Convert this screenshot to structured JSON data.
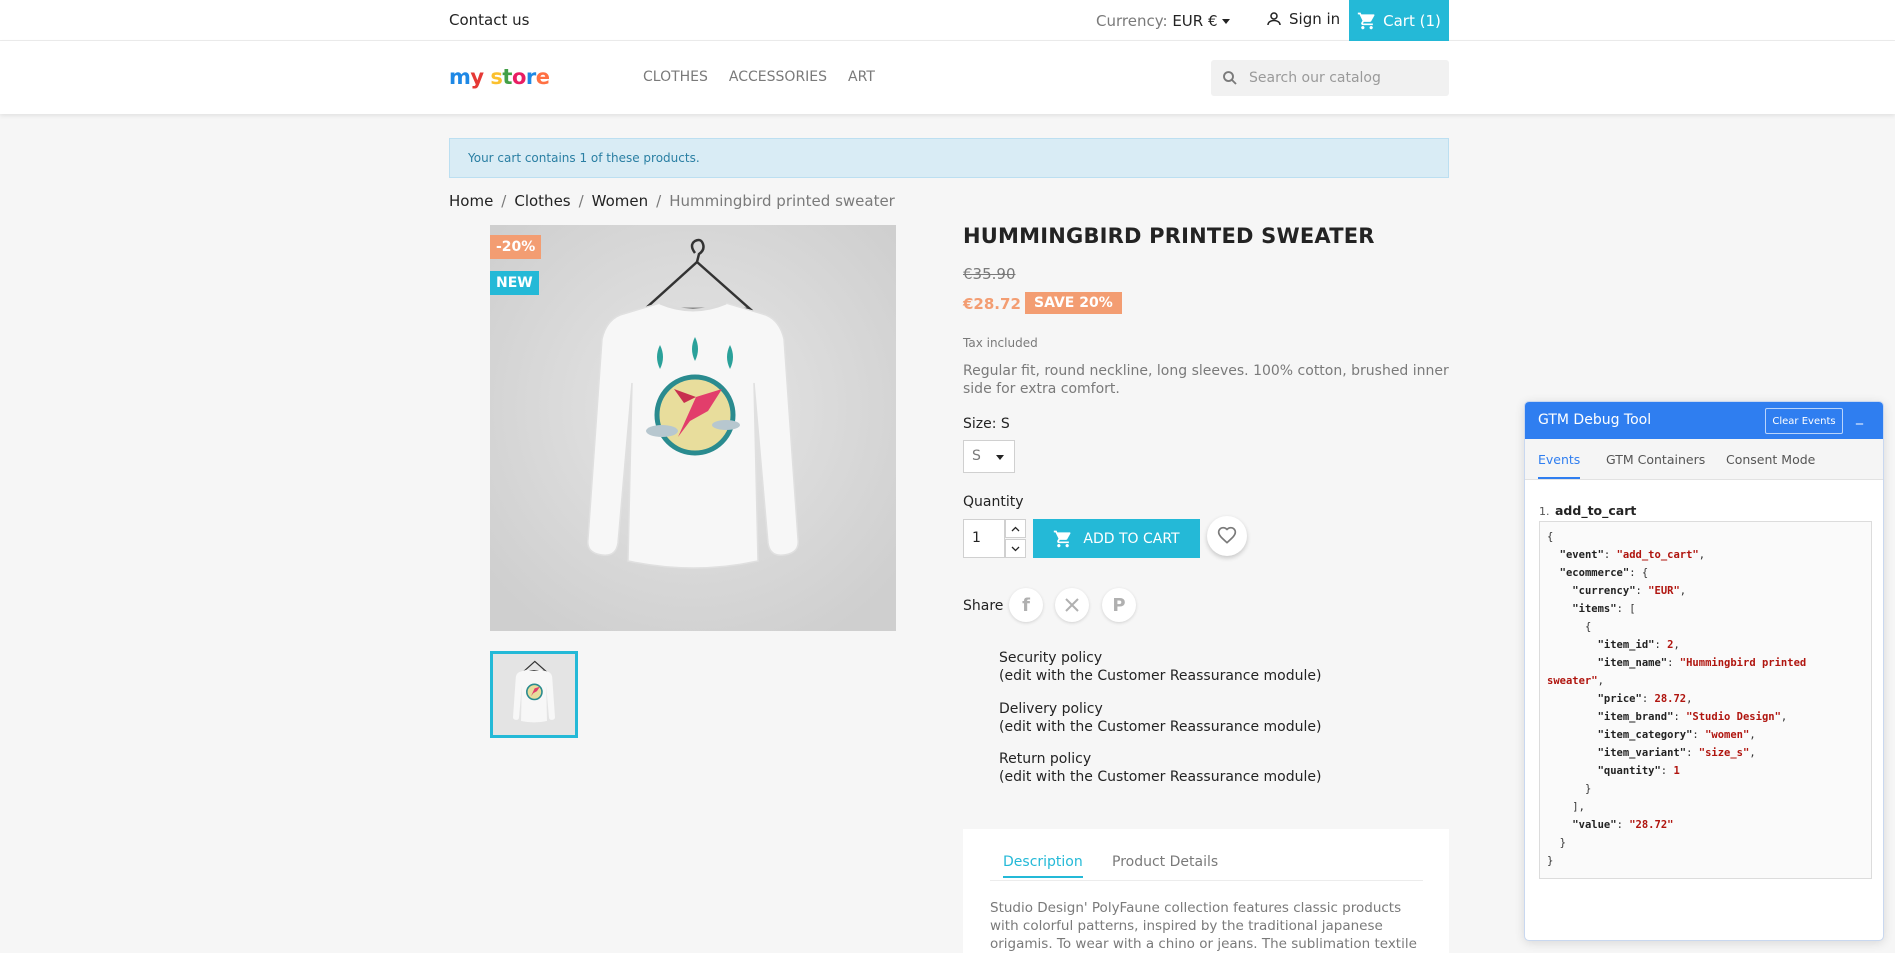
{
  "topbar": {
    "contact": "Contact us",
    "currency_label": "Currency:",
    "currency_value": "EUR €",
    "signin": "Sign in",
    "cart": "Cart (1)"
  },
  "header": {
    "logo": "my store",
    "nav": [
      "CLOTHES",
      "ACCESSORIES",
      "ART"
    ],
    "search_placeholder": "Search our catalog"
  },
  "alert": "Your cart contains 1 of these products.",
  "breadcrumb": [
    "Home",
    "Clothes",
    "Women",
    "Hummingbird printed sweater"
  ],
  "product": {
    "badge_discount": "-20%",
    "badge_new": "NEW",
    "title": "HUMMINGBIRD PRINTED SWEATER",
    "old_price": "€35.90",
    "price": "€28.72",
    "save": "SAVE 20%",
    "tax": "Tax included",
    "description": "Regular fit, round neckline, long sleeves. 100% cotton, brushed inner side for extra comfort.",
    "size_label": "Size: S",
    "size_value": "S",
    "qty_label": "Quantity",
    "qty_value": "1",
    "add_to_cart": "ADD TO CART",
    "share_label": "Share"
  },
  "reassurance": [
    {
      "title": "Security policy",
      "sub": "(edit with the Customer Reassurance module)"
    },
    {
      "title": "Delivery policy",
      "sub": "(edit with the Customer Reassurance module)"
    },
    {
      "title": "Return policy",
      "sub": "(edit with the Customer Reassurance module)"
    }
  ],
  "tabs": {
    "description": "Description",
    "details": "Product Details",
    "text": "Studio Design' PolyFaune collection features classic products with colorful patterns, inspired by the traditional japanese origamis. To wear with a chino or jeans. The sublimation textile printing process"
  },
  "gtm": {
    "title": "GTM Debug Tool",
    "clear": "Clear Events",
    "minimize": "_",
    "tabs": [
      "Events",
      "GTM Containers",
      "Consent Mode"
    ],
    "event_index": "1.",
    "event_name": "add_to_cart"
  },
  "colors": {
    "accent": "#24b9d7",
    "discount": "#f39d72",
    "gtm_blue": "#2f7ef0"
  }
}
